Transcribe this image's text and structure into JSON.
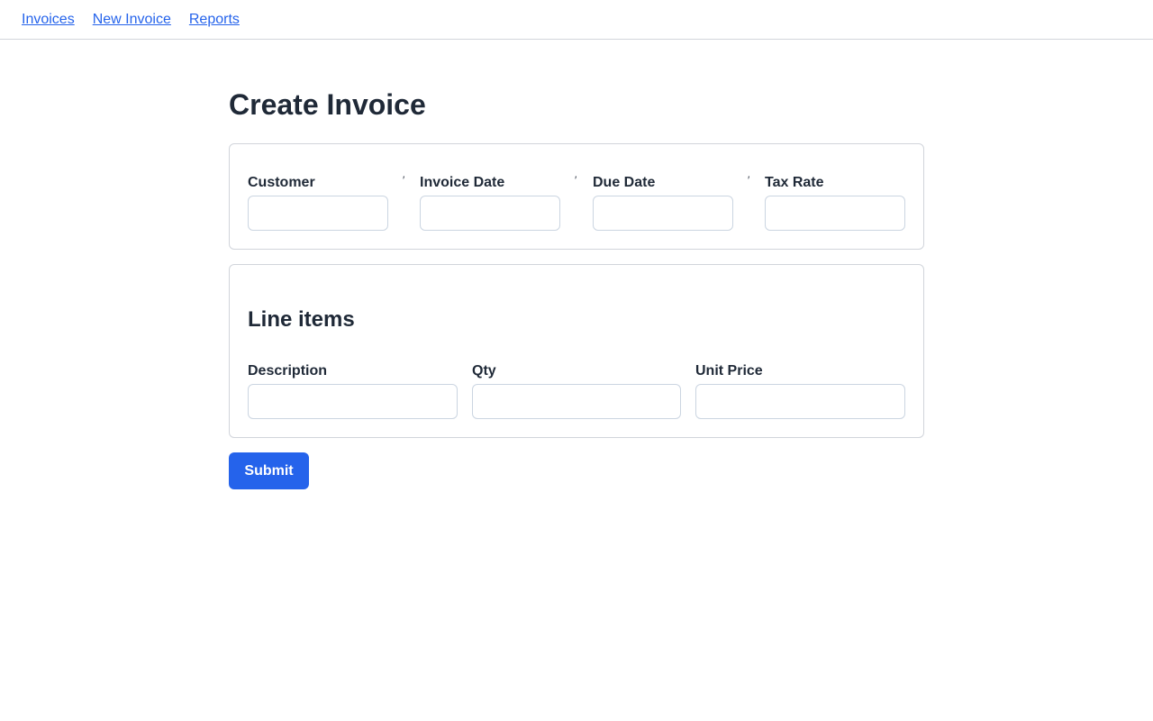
{
  "nav": {
    "links": [
      "Invoices",
      "New Invoice",
      "Reports"
    ]
  },
  "page": {
    "title": "Create Invoice"
  },
  "header_fields": [
    {
      "label": "Customer",
      "value": "",
      "placeholder": ""
    },
    {
      "label": "Invoice Date",
      "value": "",
      "placeholder": ""
    },
    {
      "label": "Due Date",
      "value": "",
      "placeholder": ""
    },
    {
      "label": "Tax Rate",
      "value": "",
      "placeholder": ""
    }
  ],
  "separator_glyph": "′",
  "line_items": {
    "title": "Line items",
    "fields": [
      {
        "label": "Description",
        "value": "",
        "placeholder": ""
      },
      {
        "label": "Qty",
        "value": "",
        "placeholder": ""
      },
      {
        "label": "Unit Price",
        "value": "",
        "placeholder": ""
      }
    ]
  },
  "actions": {
    "submit_label": "Submit"
  },
  "colors": {
    "link": "#2563eb",
    "primary_button": "#2563eb",
    "border": "#d1d5db",
    "text": "#1f2937"
  }
}
